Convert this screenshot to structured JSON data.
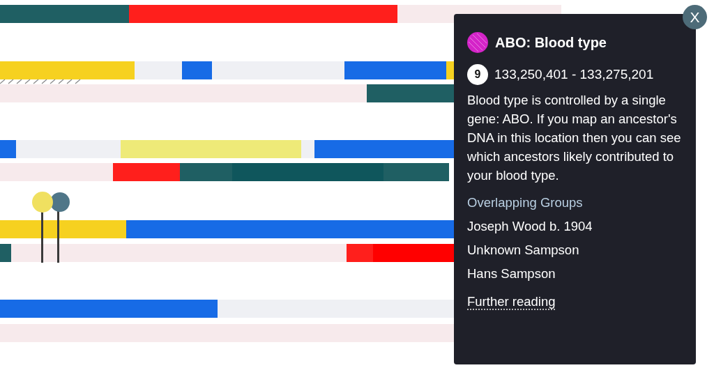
{
  "popup": {
    "close": "X",
    "title": "ABO: Blood type",
    "chromosome": "9",
    "range": "133,250,401 - 133,275,201",
    "description": "Blood type is controlled by a single gene: ABO. If you map an ancestor's DNA in this location then you can see which ancestors likely contributed to your blood type.",
    "groups_heading": "Overlapping Groups",
    "groups": [
      "Joseph Wood b. 1904",
      "Unknown Sampson",
      "Hans Sampson"
    ],
    "link": "Further reading"
  }
}
